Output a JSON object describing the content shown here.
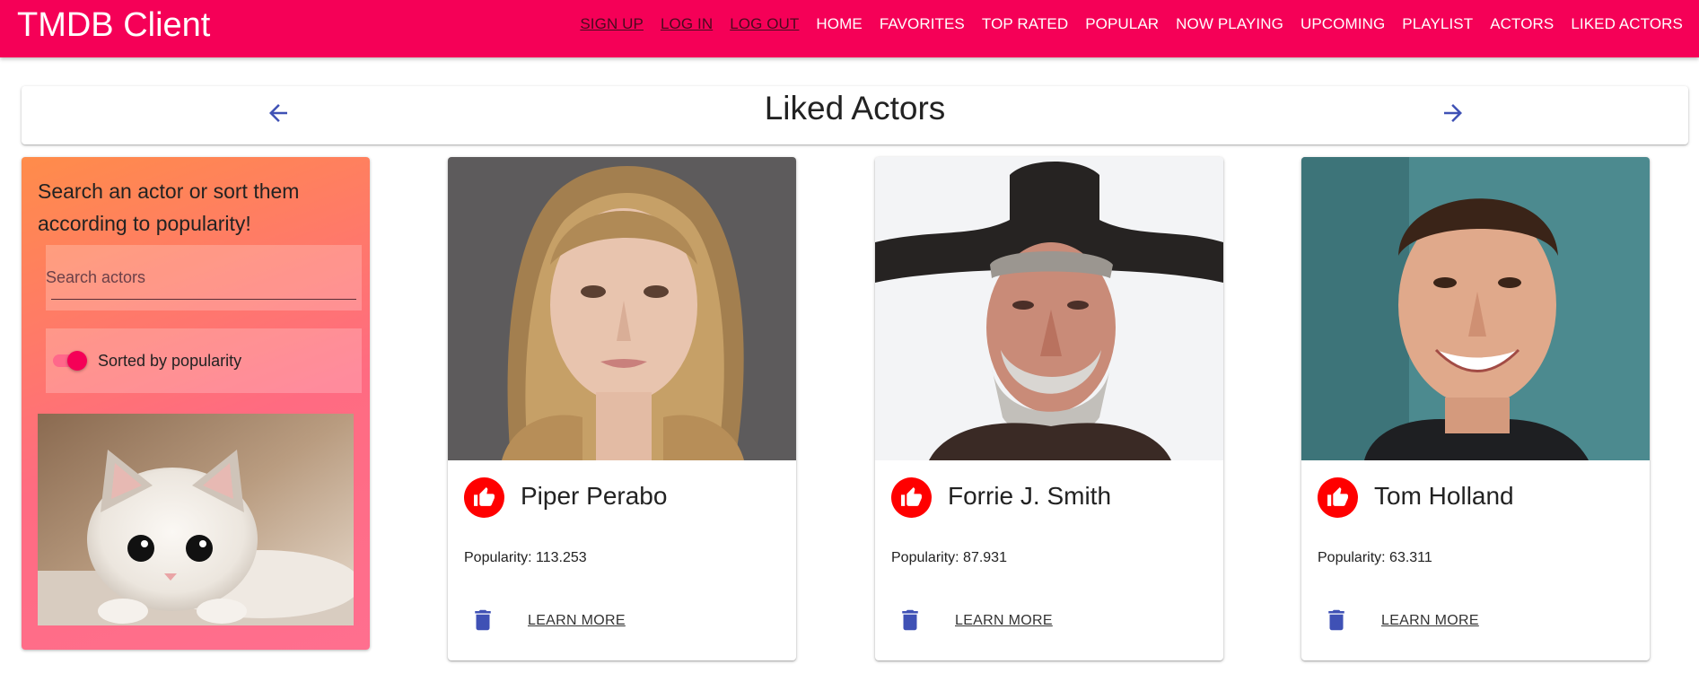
{
  "appbar": {
    "brand": "TMDB Client",
    "color": "#f50057",
    "auth_links": [
      "SIGN UP",
      "LOG IN",
      "LOG OUT"
    ],
    "nav_links": [
      "HOME",
      "FAVORITES",
      "TOP RATED",
      "POPULAR",
      "NOW PLAYING",
      "UPCOMING",
      "PLAYLIST",
      "ACTORS",
      "LIKED ACTORS"
    ]
  },
  "header": {
    "title": "Liked Actors",
    "prev_icon": "arrow-back-icon",
    "next_icon": "arrow-forward-icon",
    "icon_color": "#3f51b5"
  },
  "filter": {
    "prompt": "Search an actor or sort them according to popularity!",
    "search_placeholder": "Search actors",
    "search_value": "",
    "sort_label": "Sorted by popularity",
    "sort_enabled": true,
    "image": "cat-photo"
  },
  "actors": [
    {
      "name": "Piper Perabo",
      "popularity": "Popularity: 113.253",
      "learn_more": "LEARN MORE"
    },
    {
      "name": "Forrie J. Smith",
      "popularity": "Popularity: 87.931",
      "learn_more": "LEARN MORE"
    },
    {
      "name": "Tom Holland",
      "popularity": "Popularity: 63.311",
      "learn_more": "LEARN MORE"
    }
  ],
  "colors": {
    "like_avatar": "#ff0000",
    "action_icons": "#3f51b5"
  }
}
